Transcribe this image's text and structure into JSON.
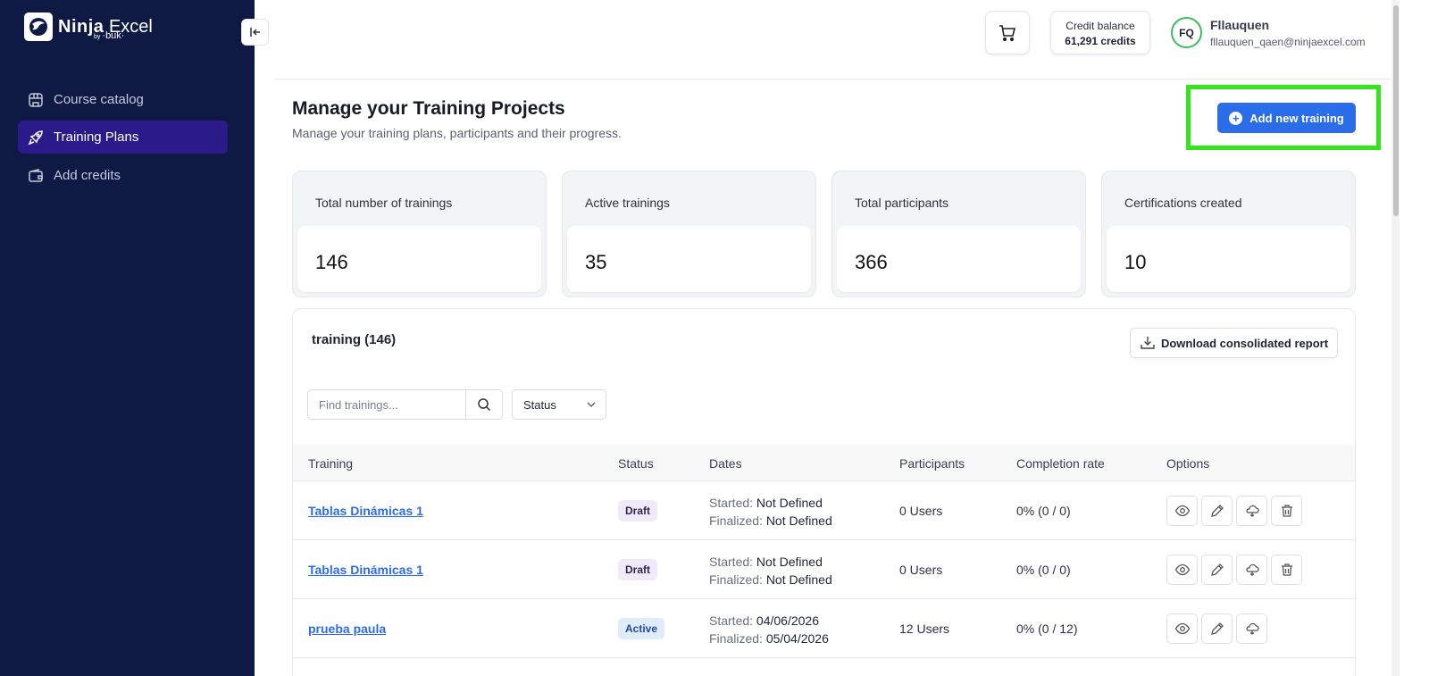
{
  "brand": {
    "name_bold": "Ninja",
    "name_light": "Excel",
    "by_small": "by",
    "by_name": "·buk·"
  },
  "sidebar": {
    "items": [
      {
        "label": "Course catalog",
        "icon": "store-icon",
        "active": false
      },
      {
        "label": "Training Plans",
        "icon": "rocket-icon",
        "active": true
      },
      {
        "label": "Add credits",
        "icon": "wallet-icon",
        "active": false
      }
    ]
  },
  "header": {
    "credit_label": "Credit balance",
    "credit_value": "61,291 credits",
    "avatar_initials": "FQ",
    "user_name": "Fllauquen",
    "user_email": "fllauquen_qaen@ninjaexcel.com"
  },
  "page": {
    "title": "Manage your Training Projects",
    "subtitle": "Manage your training plans, participants and their progress.",
    "add_button": "Add new training"
  },
  "stats": [
    {
      "label": "Total number of trainings",
      "value": "146"
    },
    {
      "label": "Active trainings",
      "value": "35"
    },
    {
      "label": "Total participants",
      "value": "366"
    },
    {
      "label": "Certifications created",
      "value": "10"
    }
  ],
  "panel": {
    "title": "training (146)",
    "download_button": "Download consolidated report",
    "search_placeholder": "Find trainings...",
    "status_filter": "Status"
  },
  "table": {
    "headers": [
      "Training",
      "Status",
      "Dates",
      "Participants",
      "Completion rate",
      "Options"
    ],
    "rows": [
      {
        "training": "Tablas Dinámicas 1",
        "status": "Draft",
        "started_key": "Started:",
        "started": "Not Defined",
        "finalized_key": "Finalized:",
        "finalized": "Not Defined",
        "participants": "0 Users",
        "rate": "0% (0 / 0)"
      },
      {
        "training": "Tablas Dinámicas 1",
        "status": "Draft",
        "started_key": "Started:",
        "started": "Not Defined",
        "finalized_key": "Finalized:",
        "finalized": "Not Defined",
        "participants": "0 Users",
        "rate": "0% (0 / 0)"
      },
      {
        "training": "prueba paula",
        "status": "Active",
        "started_key": "Started:",
        "started": "04/06/2026",
        "finalized_key": "Finalized:",
        "finalized": "05/04/2026",
        "participants": "12 Users",
        "rate": "0% (0 / 12)"
      }
    ]
  },
  "colors": {
    "sidebar_bg": "#0f1a44",
    "active_nav": "#2a1a8a",
    "primary": "#2b6de8",
    "highlight": "#35e51c",
    "avatar_ring": "#3dbb5f"
  }
}
